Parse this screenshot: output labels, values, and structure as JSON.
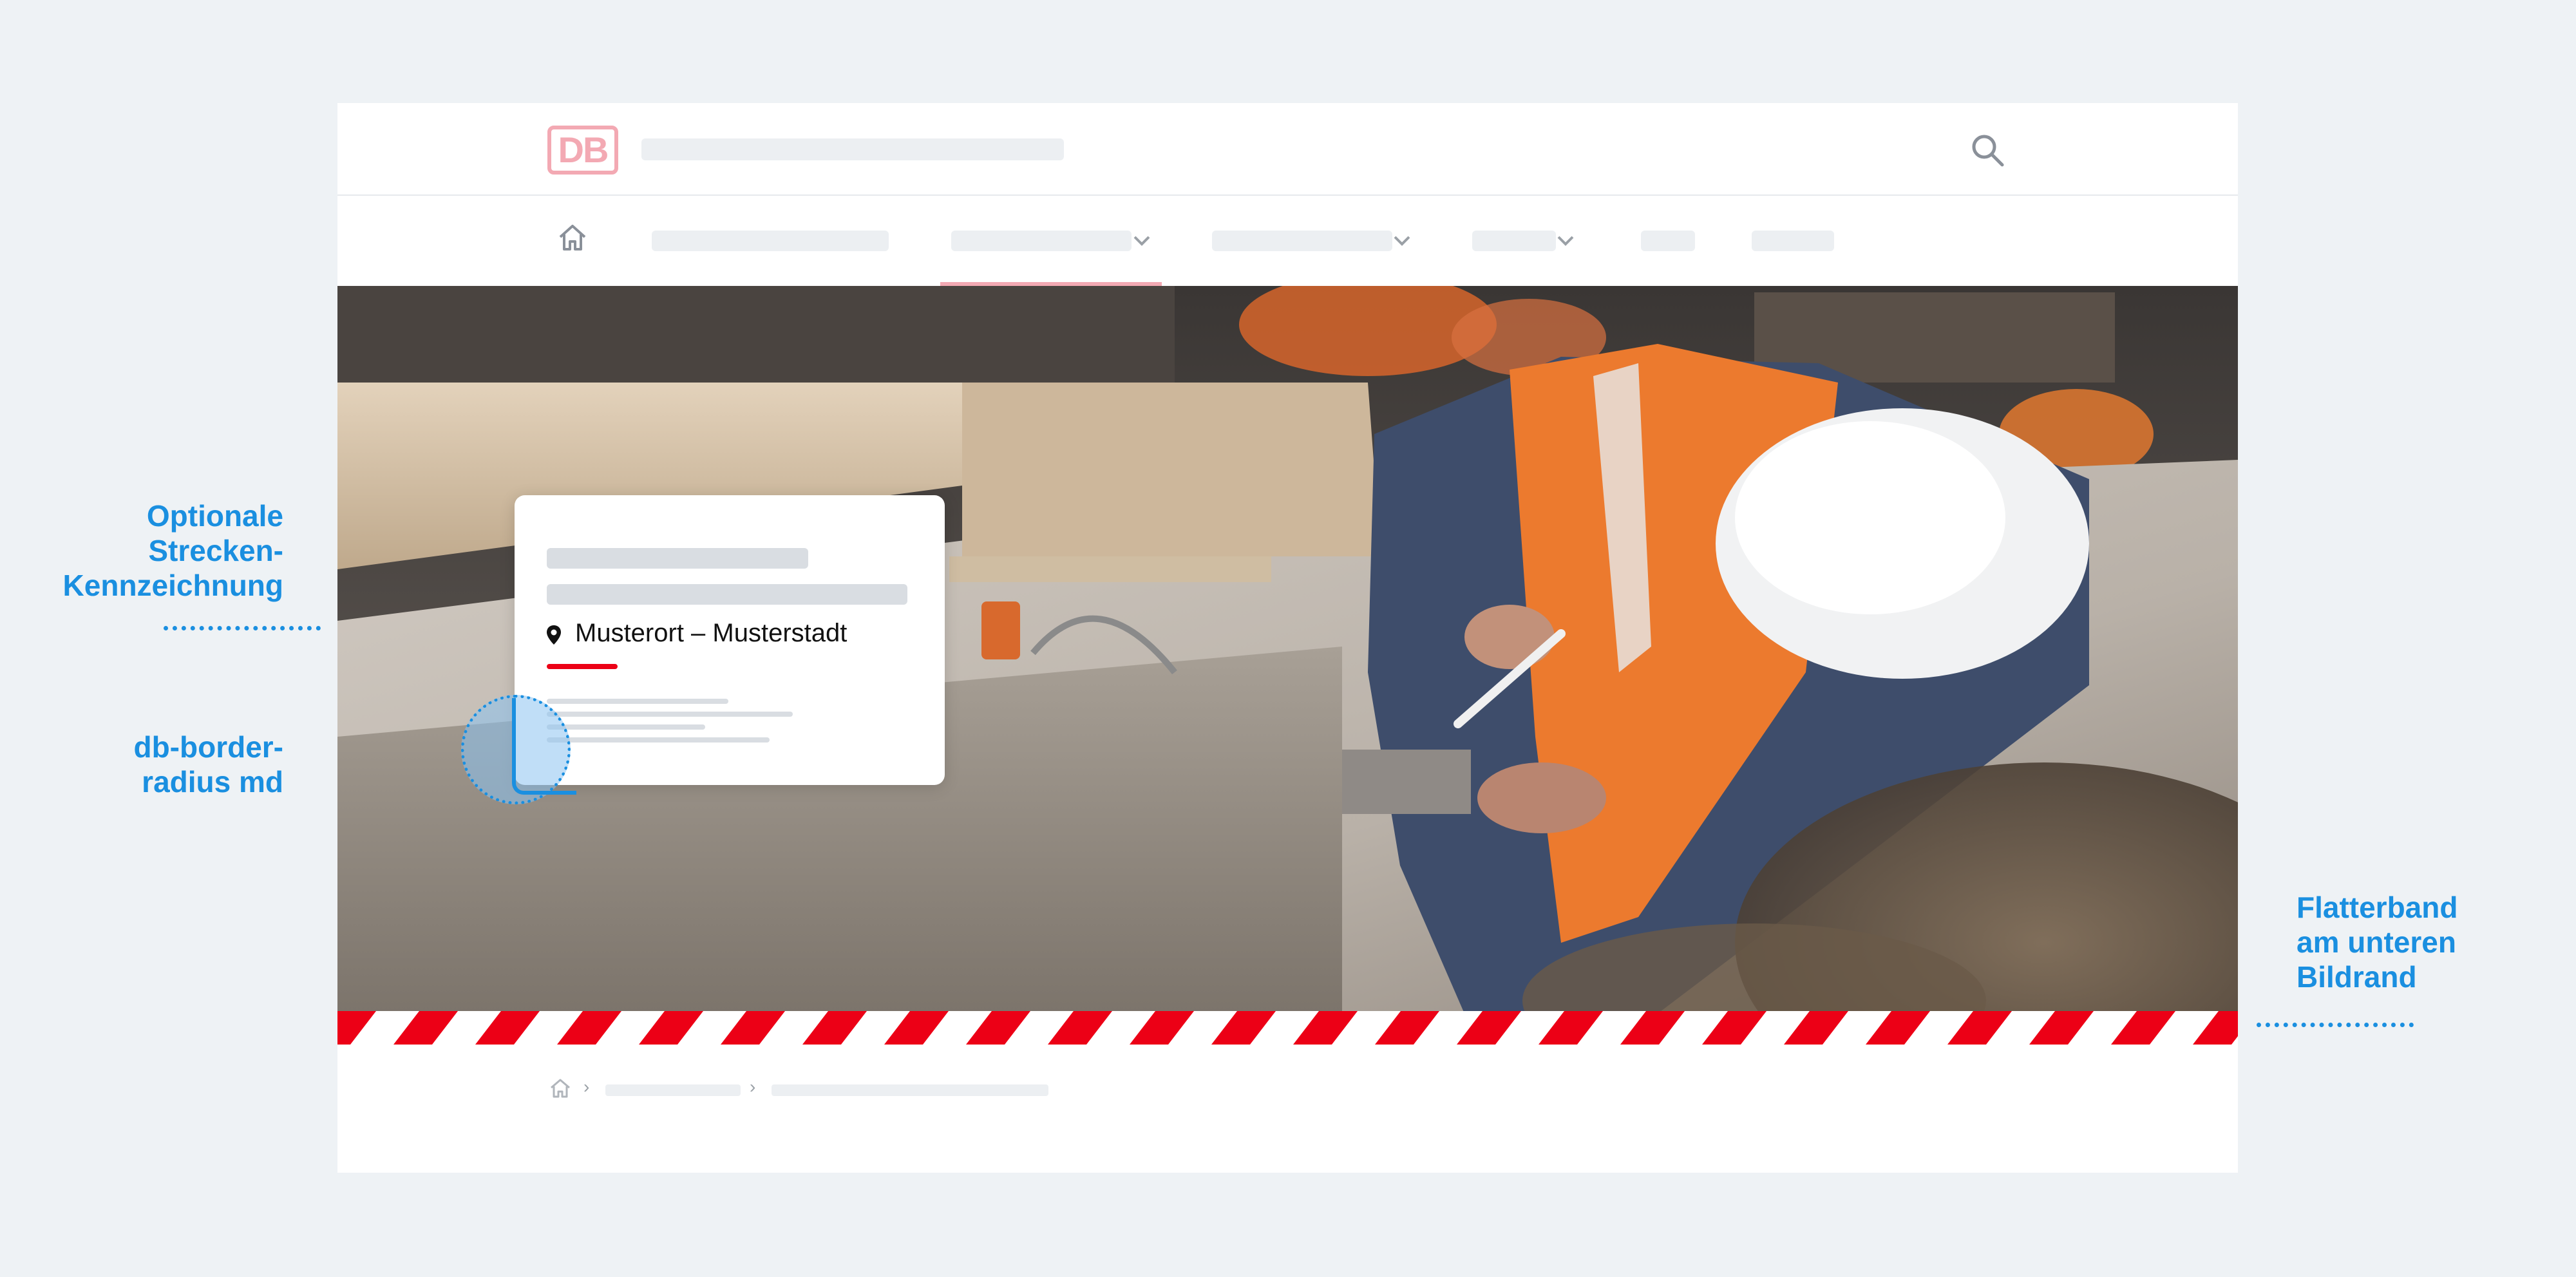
{
  "header": {
    "logo_text": "DB",
    "search_icon": "search-icon"
  },
  "nav": {
    "home_icon": "home-icon",
    "active_index": 1
  },
  "card": {
    "location_icon": "map-pin-icon",
    "location_text": "Musterort – Musterstadt"
  },
  "breadcrumb": {
    "home_icon": "home-icon",
    "separator": "›"
  },
  "annotations": {
    "route_label": "Optionale\nStrecken-\nKennzeichnung",
    "radius_label": "db-border-\nradius md",
    "tape_label": "Flatterband\nam unteren\nBildrand"
  },
  "colors": {
    "annotation_blue": "#1a8fe0",
    "db_red": "#ec0016",
    "logo_pink": "#f3a9b3",
    "background": "#eef2f5"
  }
}
